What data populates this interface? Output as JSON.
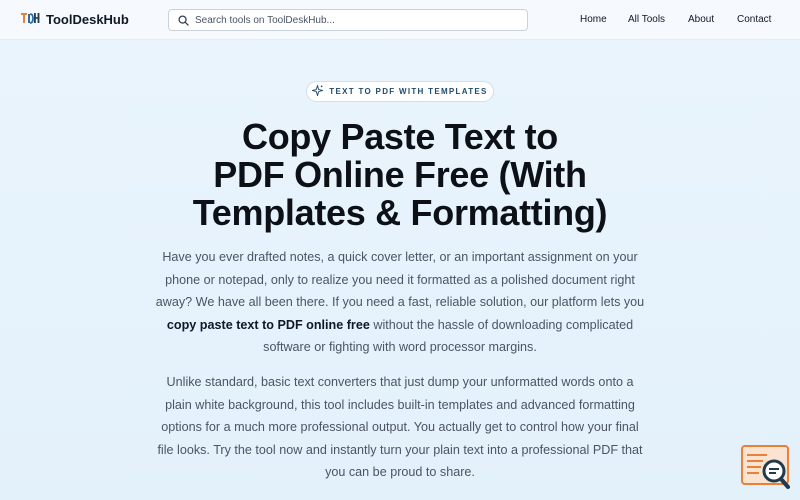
{
  "header": {
    "brand": "ToolDeskHub",
    "logo_letters": "TDH",
    "search_placeholder": "Search tools on ToolDeskHub...",
    "nav": [
      "Home",
      "All Tools",
      "About",
      "Contact"
    ]
  },
  "badge": {
    "label": "TEXT TO PDF WITH TEMPLATES",
    "icon": "sparkle-icon"
  },
  "title_lines": [
    "Copy Paste Text to",
    "PDF Online Free (With",
    "Templates & Formatting)"
  ],
  "intro": {
    "line1": "Have you ever drafted notes, a quick cover letter, or an important assignment on your",
    "line2": "phone or notepad, only to realize you need it formatted as a polished document right",
    "line3": "away? We have all been there. If you need a fast, reliable solution, our platform lets you",
    "line4_bold": "copy paste text to PDF online free",
    "line4_rest": " without the hassle of downloading complicated",
    "line5": "software or fighting with word processor margins."
  },
  "second": {
    "lines": [
      "Unlike standard, basic text converters that just dump your unformatted words onto a",
      "plain white background, this tool includes built-in templates and advanced formatting",
      "options for a much more professional output. You actually get to control how your final",
      "file looks. Try the tool now and instantly turn your plain text into a professional PDF that",
      "you can be proud to share."
    ]
  },
  "colors": {
    "accent_orange": "#e8823a",
    "accent_blue": "#2b6cb0",
    "dark_teal": "#1f3b4d"
  }
}
